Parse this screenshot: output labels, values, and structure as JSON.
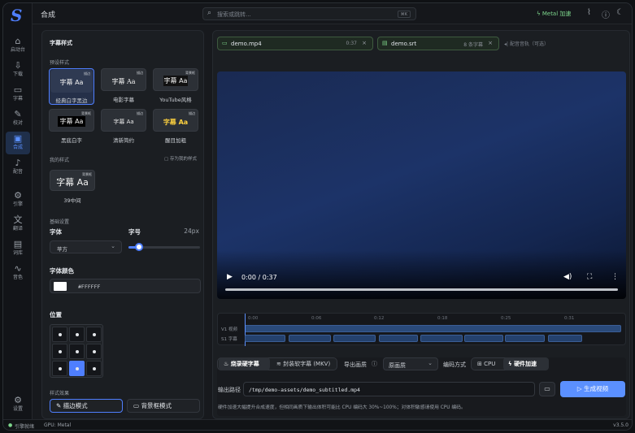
{
  "app": {
    "title": "合成",
    "version": "v3.5.0"
  },
  "nav": [
    {
      "label": "启动台",
      "icon": "home-icon"
    },
    {
      "label": "下载",
      "icon": "download-icon"
    },
    {
      "label": "字幕",
      "icon": "subtitle-icon"
    },
    {
      "label": "校对",
      "icon": "pen-icon"
    },
    {
      "label": "合成",
      "icon": "compose-icon"
    },
    {
      "label": "配音",
      "icon": "mic-icon"
    },
    {
      "label": "引擎",
      "icon": "chip-icon"
    },
    {
      "label": "翻译",
      "icon": "translate-icon"
    },
    {
      "label": "词库",
      "icon": "book-icon"
    },
    {
      "label": "音色",
      "icon": "waveform-icon"
    }
  ],
  "settings_label": "设置",
  "search": {
    "placeholder": "搜索或跳转...",
    "shortcut": "⌘K"
  },
  "topbar": {
    "metal_label": "Metal 加速"
  },
  "style_panel": {
    "title": "字幕样式",
    "preset_header": "预设样式",
    "presets": [
      {
        "sample": "字幕 Aa",
        "tag": "描边",
        "name": "经典白字黑边"
      },
      {
        "sample": "字幕 Aa",
        "tag": "描边",
        "name": "电影字幕"
      },
      {
        "sample": "字幕 Aa",
        "tag": "背景框",
        "name": "YouTube风格"
      },
      {
        "sample": "字幕 Aa",
        "tag": "背景框",
        "name": "黑底白字"
      },
      {
        "sample": "字幕 Aa",
        "tag": "描边",
        "name": "清新简约"
      },
      {
        "sample": "字幕 Aa",
        "tag": "描边",
        "name": "醒目加粗"
      }
    ],
    "my_styles_header": "我的样式",
    "save_link": "存为我的样式",
    "my_style": {
      "sample": "字幕 Aa",
      "tag": "背景框",
      "name": "39中间"
    },
    "basic_header": "基础设置",
    "font_label": "字体",
    "font_value": "苹方",
    "size_label": "字号",
    "size_value": "24px",
    "size_fraction": 0.15,
    "color_label": "字体颜色",
    "color_value": "#FFFFFF",
    "position_label": "位置",
    "position_selected": "bottom-center",
    "effects_header": "样式效果",
    "effect_outline": "描边模式",
    "effect_box": "背景框模式"
  },
  "files": {
    "video": {
      "name": "demo.mp4",
      "meta": "0:37"
    },
    "subtitle": {
      "name": "demo.srt",
      "meta": "8 条字幕"
    },
    "audio_placeholder": "配音音轨（可选）"
  },
  "player": {
    "time": "0:00 / 0:37",
    "progress": 0.0
  },
  "timeline": {
    "ticks": [
      "0:00",
      "0:06",
      "0:12",
      "0:18",
      "0:25",
      "0:31"
    ],
    "video_track_label": "V1 视频",
    "subtitle_track_label": "S1 字幕",
    "subtitle_segments": [
      [
        0.0,
        4.0
      ],
      [
        4.3,
        8.5
      ],
      [
        8.7,
        12.9
      ],
      [
        13.2,
        17.0
      ],
      [
        17.3,
        21.4
      ],
      [
        21.6,
        25.4
      ],
      [
        25.6,
        29.5
      ],
      [
        29.8,
        33.2
      ]
    ],
    "duration": 37
  },
  "controls": {
    "burn_hard": "烧录硬字幕",
    "soft_mkv": "封装软字幕 (MKV)",
    "quality_label": "导出画质",
    "quality_value": "原画质",
    "encode_label": "编码方式",
    "encode_cpu": "CPU",
    "encode_hw": "硬件加速",
    "output_label": "输出路径",
    "output_path": "/tmp/demo-assets/demo_subtitled.mp4",
    "generate": "生成视频",
    "note": "硬件加速大幅提升合成速度，但相同画质下输出体积可能比 CPU 编码大 30%~100%；对体积敏感请使用 CPU 编码。"
  },
  "status": {
    "engine": "引擎就绪",
    "gpu": "GPU: Metal"
  },
  "colors": {
    "accent": "#5b90ff",
    "ok": "#7dd68c"
  }
}
